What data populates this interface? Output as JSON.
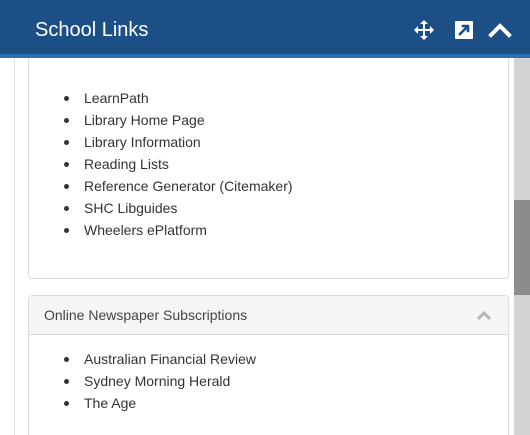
{
  "header": {
    "title": "School Links",
    "icons": [
      "move-icon",
      "expand-icon",
      "collapse-icon"
    ]
  },
  "panels": [
    {
      "items": [
        "LearnPath",
        "Library Home Page",
        "Library Information",
        "Reading Lists",
        "Reference Generator (Citemaker)",
        "SHC Libguides",
        "Wheelers ePlatform"
      ]
    },
    {
      "heading": "Online Newspaper Subscriptions",
      "items": [
        "Australian Financial Review",
        "Sydney Morning Herald",
        "The Age"
      ]
    }
  ],
  "colors": {
    "header_bg": "#1d4f87",
    "header_border": "#2a6fb4",
    "panel_heading_bg": "#f5f5f5",
    "text": "#333333"
  }
}
